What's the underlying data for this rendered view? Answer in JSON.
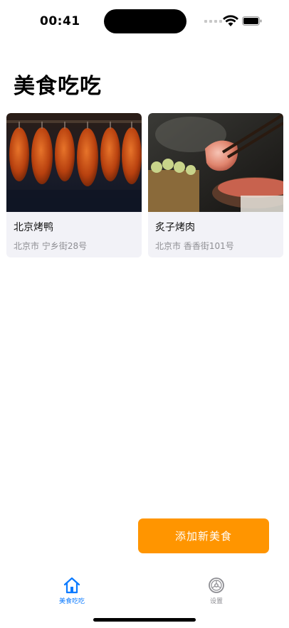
{
  "status_bar": {
    "time": "00:41"
  },
  "page": {
    "title": "美食吃吃"
  },
  "cards": [
    {
      "name": "北京烤鸭",
      "address": "北京市 宁乡街28号",
      "image_icon": "roast-duck-photo"
    },
    {
      "name": "炙子烤肉",
      "address": "北京市 香香街101号",
      "image_icon": "grilled-meat-photo"
    }
  ],
  "add_button": {
    "label": "添加新美食",
    "color": "#ff9500"
  },
  "tab_bar": {
    "tabs": [
      {
        "label": "美食吃吃",
        "icon": "house-icon",
        "active": true
      },
      {
        "label": "设置",
        "icon": "gear-icon",
        "active": false
      }
    ],
    "active_color": "#0a7aff",
    "inactive_color": "#8e8e93"
  }
}
